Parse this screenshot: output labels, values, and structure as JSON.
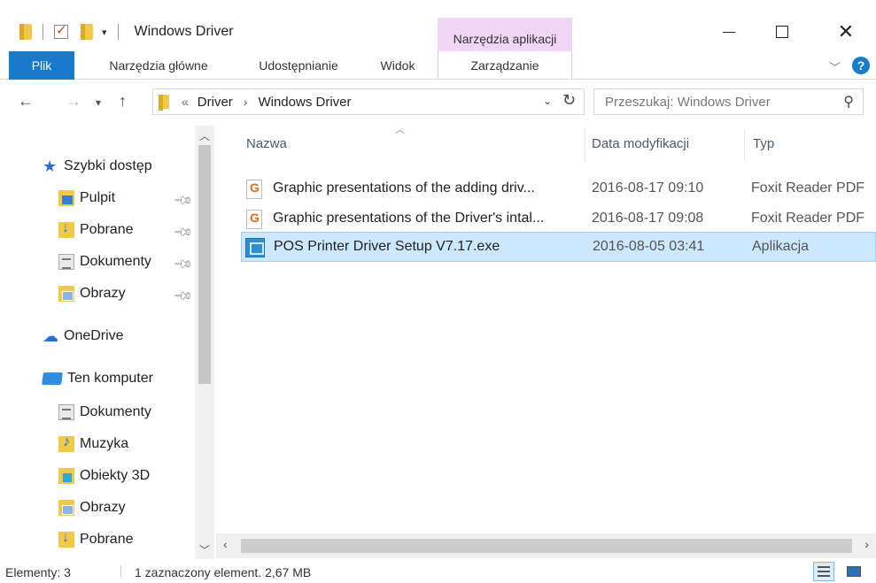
{
  "window": {
    "title": "Windows Driver",
    "context_tab_group": "Narzędzia aplikacji"
  },
  "ribbon": {
    "tabs": [
      "Plik",
      "Narzędzia główne",
      "Udostępnianie",
      "Widok",
      "Zarządzanie"
    ],
    "help": "?"
  },
  "address": {
    "overflow": "«",
    "segments": [
      "Driver",
      "Windows Driver"
    ],
    "separator": "›"
  },
  "search": {
    "placeholder": "Przeszukaj: Windows Driver"
  },
  "sidebar": {
    "items": [
      {
        "label": "Szybki dostęp",
        "icon": "star-icon"
      },
      {
        "label": "Pulpit",
        "icon": "desktop-folder-icon",
        "pinned": true
      },
      {
        "label": "Pobrane",
        "icon": "downloads-folder-icon",
        "pinned": true
      },
      {
        "label": "Dokumenty",
        "icon": "documents-folder-icon",
        "pinned": true
      },
      {
        "label": "Obrazy",
        "icon": "pictures-folder-icon",
        "pinned": true
      },
      {
        "label": "OneDrive",
        "icon": "cloud-icon"
      },
      {
        "label": "Ten komputer",
        "icon": "computer-icon"
      },
      {
        "label": "Dokumenty",
        "icon": "documents-folder-icon"
      },
      {
        "label": "Muzyka",
        "icon": "music-folder-icon"
      },
      {
        "label": "Obiekty 3D",
        "icon": "objects-3d-folder-icon"
      },
      {
        "label": "Obrazy",
        "icon": "pictures-folder-icon"
      },
      {
        "label": "Pobrane",
        "icon": "downloads-folder-icon"
      }
    ]
  },
  "columns": [
    "Nazwa",
    "Data modyfikacji",
    "Typ"
  ],
  "files": [
    {
      "name": "Graphic presentations of the adding driv...",
      "date": "2016-08-17 09:10",
      "type": "Foxit Reader PDF",
      "icon": "pdf-file-icon",
      "selected": false
    },
    {
      "name": "Graphic presentations of the Driver's intal...",
      "date": "2016-08-17 09:08",
      "type": "Foxit Reader PDF",
      "icon": "pdf-file-icon",
      "selected": false
    },
    {
      "name": "POS Printer Driver Setup V7.17.exe",
      "date": "2016-08-05 03:41",
      "type": "Aplikacja",
      "icon": "exe-file-icon",
      "selected": true
    }
  ],
  "status": {
    "count": "Elementy: 3",
    "selection": "1 zaznaczony element. 2,67 MB"
  },
  "colors": {
    "accent": "#1979ca",
    "context_tab": "#f0d6f5",
    "selection_bg": "#cce8ff",
    "selection_border": "#99d1ff"
  }
}
